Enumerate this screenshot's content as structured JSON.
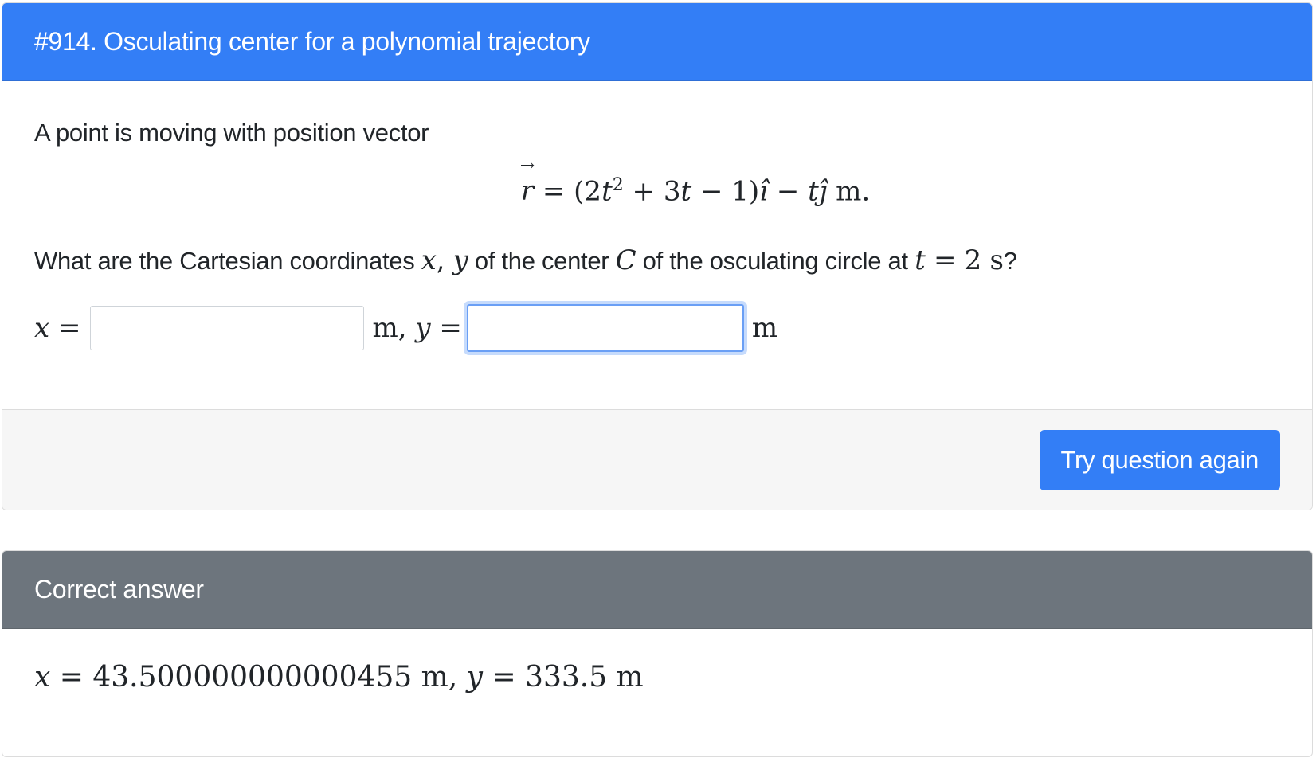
{
  "question_card": {
    "title": "#914. Osculating center for a polynomial trajectory",
    "intro": "A point is moving with position vector",
    "equation": {
      "lhs": "r",
      "lhs_arrow": "→",
      "equals": " = ",
      "open": "(2",
      "t1": "t",
      "exp": "2",
      "plus": " + 3",
      "t2": "t",
      "minus1": " − 1)",
      "i_hat": "ı̂",
      "minus2": " − ",
      "t3": "t",
      "j_hat": "ȷ̂",
      "unit": " m."
    },
    "question": {
      "part1": "What are the Cartesian coordinates ",
      "x": "x",
      "comma": ", ",
      "y": "y",
      "part2": " of the center ",
      "C": "C",
      "part3": " of the osculating circle at ",
      "t": "t",
      "equals": " = 2 s",
      "end": "?"
    },
    "inputs": {
      "x_label": "x",
      "x_equals": " =",
      "x_value": "",
      "x_unit": "m, ",
      "y_label": "y",
      "y_equals": " =",
      "y_value": "",
      "y_unit": "m"
    },
    "button_label": "Try question again"
  },
  "answer_card": {
    "title": "Correct answer",
    "x_label": "x",
    "x_text": " = 43.500000000000455 m, ",
    "y_label": "y",
    "y_text": " = 333.5 m"
  },
  "colors": {
    "primary": "#337ef6",
    "secondary": "#6d757d",
    "footer_bg": "#f6f6f6"
  }
}
